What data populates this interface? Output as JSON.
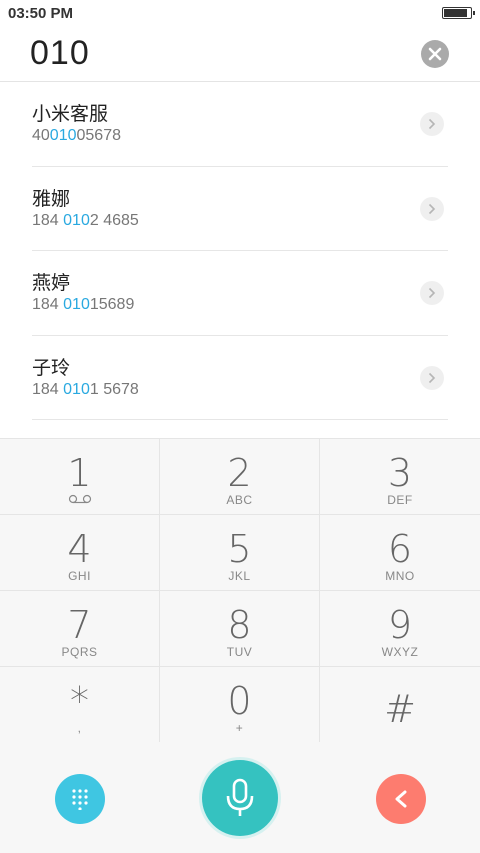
{
  "status_bar": {
    "time": "03:50 PM",
    "battery_level": 0.9
  },
  "dial_input": {
    "value": "010"
  },
  "icons": {
    "clear": "close-circle-icon",
    "row_detail": "chevron-right-icon",
    "voicemail": "voicemail-icon",
    "dialpad": "dialpad-grid-icon",
    "microphone": "microphone-icon",
    "delete": "backspace-chevron-icon"
  },
  "colors": {
    "highlight": "#2aa9e0",
    "dialpad_button": "#3fc6e2",
    "mic_button": "#35c2c0",
    "delete_button": "#fd7c6f"
  },
  "results": [
    {
      "name": "小米客服",
      "number_pre": "40",
      "number_match": "010",
      "number_post": "05678"
    },
    {
      "name": "雅娜",
      "number_pre": "184 ",
      "number_match": "010",
      "number_post": "2 4685"
    },
    {
      "name": "燕婷",
      "number_pre": "184 ",
      "number_match": "010",
      "number_post": "15689"
    },
    {
      "name": "子玲",
      "number_pre": "184 ",
      "number_match": "010",
      "number_post": "1 5678"
    }
  ],
  "keypad": [
    {
      "digit": "1",
      "letters": ""
    },
    {
      "digit": "2",
      "letters": "ABC"
    },
    {
      "digit": "3",
      "letters": "DEF"
    },
    {
      "digit": "4",
      "letters": "GHI"
    },
    {
      "digit": "5",
      "letters": "JKL"
    },
    {
      "digit": "6",
      "letters": "MNO"
    },
    {
      "digit": "7",
      "letters": "PQRS"
    },
    {
      "digit": "8",
      "letters": "TUV"
    },
    {
      "digit": "9",
      "letters": "WXYZ"
    },
    {
      "digit": "*",
      "letters": ","
    },
    {
      "digit": "0",
      "letters": "+"
    },
    {
      "digit": "#",
      "letters": ""
    }
  ]
}
